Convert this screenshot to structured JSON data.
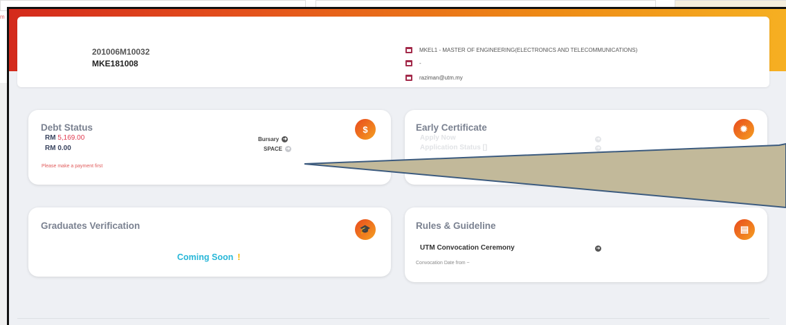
{
  "background": {
    "edge_text": "m"
  },
  "profile": {
    "student_id": "201006M10032",
    "matric_no": "MKE181008",
    "program": "MKEL1 - MASTER OF ENGINEERING(ELECTRONICS AND TELECOMMUNICATIONS)",
    "date_line": "-",
    "email": "raziman@utm.my"
  },
  "debt_card": {
    "title": "Debt Status",
    "line1_prefix": "RM",
    "line1_amount": "5,169.00",
    "line2": "RM 0.00",
    "link1": "Bursary",
    "link2": "SPACE",
    "warning": "Please make a payment first",
    "badge_icon": "money-hand-icon"
  },
  "early_card": {
    "title": "Early Certificate",
    "item1": "Apply Now",
    "item2": "Application Status []",
    "badge_icon": "certificate-seal-icon"
  },
  "graduates_card": {
    "title": "Graduates Verification",
    "coming": "Coming Soon",
    "excl": "!",
    "badge_icon": "graduation-cap-icon"
  },
  "rules_card": {
    "title": "Rules & Guideline",
    "item": "UTM Convocation Ceremony",
    "note": "Convocation Date from ~",
    "badge_icon": "document-icon"
  },
  "colors": {
    "accent_gradient_start": "#d42a1c",
    "accent_gradient_end": "#f6b022",
    "debt_red": "#e0394f",
    "coming_soon": "#28b7d8",
    "callout_fill": "#c2b99a",
    "callout_stroke": "#3b5a7e"
  }
}
